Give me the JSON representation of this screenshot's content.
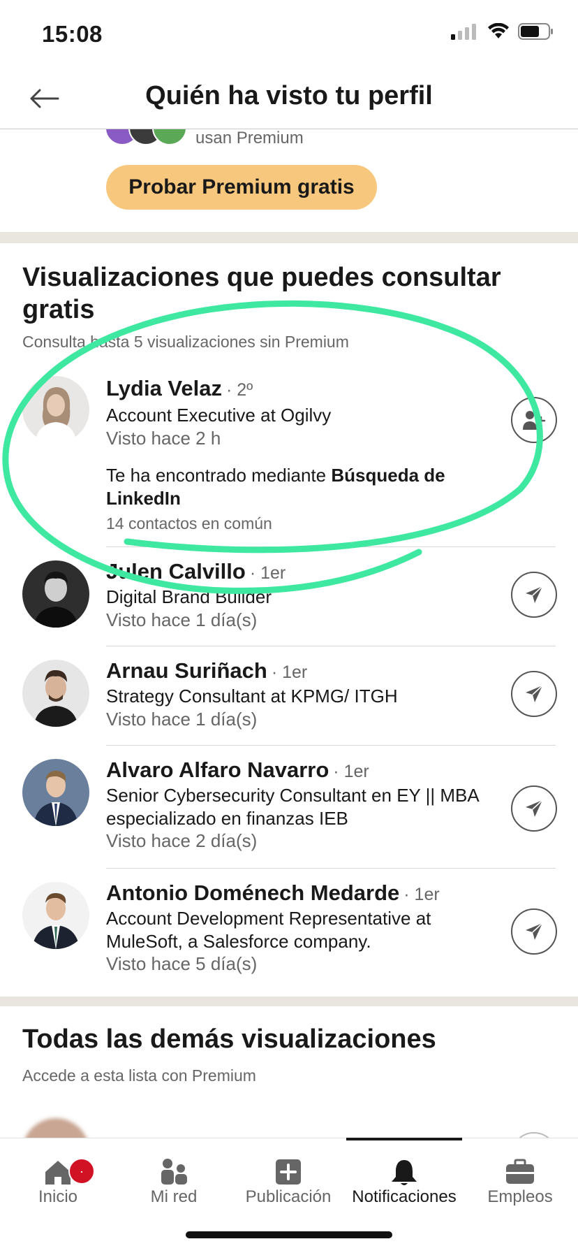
{
  "status_bar": {
    "time": "15:08"
  },
  "header": {
    "title": "Quién ha visto tu perfil"
  },
  "premium": {
    "note": "usan Premium",
    "cta_label": "Probar Premium gratis"
  },
  "free_section": {
    "title": "Visualizaciones que puedes consultar gratis",
    "subtitle": "Consulta hasta 5 visualizaciones sin Premium",
    "viewers": [
      {
        "name": "Lydia Velaz",
        "degree": "· 2º",
        "headline": "Account Executive at Ogilvy",
        "time": "Visto hace 2 h",
        "found_via_prefix": "Te ha encontrado mediante",
        "found_via_source": "Búsqueda de LinkedIn",
        "mutual": "14 contactos en común",
        "action_icon": "connect-icon"
      },
      {
        "name": "Julen Calvillo",
        "degree": "· 1er",
        "headline": "Digital Brand Builder",
        "time": "Visto hace 1 día(s)",
        "action_icon": "send-icon"
      },
      {
        "name": "Arnau Suriñach",
        "degree": "· 1er",
        "headline": "Strategy Consultant at KPMG/ ITGH",
        "time": "Visto hace 1 día(s)",
        "action_icon": "send-icon"
      },
      {
        "name": "Alvaro Alfaro Navarro",
        "degree": "· 1er",
        "headline": "Senior Cybersecurity Consultant en EY || MBA especializado en finanzas IEB",
        "time": "Visto hace 2 día(s)",
        "action_icon": "send-icon"
      },
      {
        "name": "Antonio Doménech Medarde",
        "degree": "· 1er",
        "headline": "Account Development Representative at MuleSoft, a Salesforce company.",
        "time": "Visto hace 5 día(s)",
        "action_icon": "send-icon"
      }
    ]
  },
  "others_section": {
    "title": "Todas las demás visualizaciones",
    "subtitle": "Accede a esta lista con Premium"
  },
  "bottom_nav": {
    "items": [
      {
        "label": "Inicio",
        "icon": "home-icon",
        "badge": "·"
      },
      {
        "label": "Mi red",
        "icon": "network-icon"
      },
      {
        "label": "Publicación",
        "icon": "post-icon"
      },
      {
        "label": "Notificaciones",
        "icon": "bell-icon",
        "active": true
      },
      {
        "label": "Empleos",
        "icon": "briefcase-icon"
      }
    ]
  },
  "colors": {
    "premium_button": "#f8c77e",
    "annotation_stroke": "#3ee8a0",
    "badge": "#d11124",
    "divider_band": "#e9e5df"
  }
}
